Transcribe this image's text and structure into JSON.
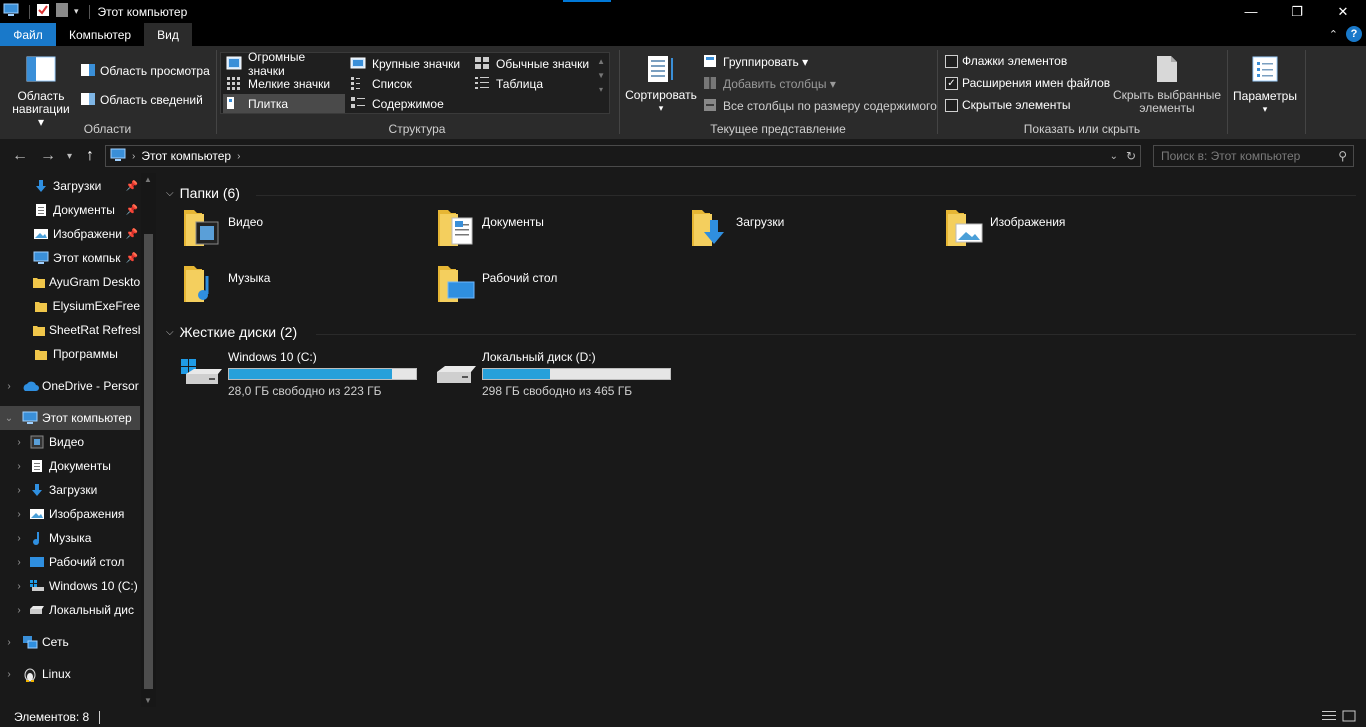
{
  "window": {
    "title": "Этот компьютер",
    "minimize": "—",
    "maximize": "❐",
    "close": "✕"
  },
  "ribbon_tabs": [
    "Файл",
    "Компьютер",
    "Вид"
  ],
  "ribbon": {
    "panes": {
      "navigation_pane": "Область\nнавигации",
      "navigation_pane_line1": "Область",
      "navigation_pane_line2": "навигации ▾",
      "preview_pane": "Область просмотра",
      "details_pane": "Область сведений",
      "label": "Области"
    },
    "layout": {
      "items": [
        "Огромные значки",
        "Крупные значки",
        "Обычные значки",
        "Мелкие значки",
        "Список",
        "Таблица",
        "Плитка",
        "Содержимое"
      ],
      "selected": "Плитка",
      "label": "Структура"
    },
    "current_view": {
      "sort_by": "Сортировать",
      "group_by": "Группировать ▾",
      "add_columns": "Добавить столбцы ▾",
      "size_all_columns": "Все столбцы по размеру содержимого",
      "label": "Текущее представление"
    },
    "show_hide": {
      "item_checkboxes": "Флажки элементов",
      "item_checkboxes_checked": false,
      "file_extensions": "Расширения имен файлов",
      "file_extensions_checked": true,
      "hidden_items": "Скрытые элементы",
      "hidden_items_checked": false,
      "hide_selected_line1": "Скрыть выбранные",
      "hide_selected_line2": "элементы",
      "label": "Показать или скрыть"
    },
    "options": "Параметры"
  },
  "address": {
    "path": "Этот компьютер",
    "search_placeholder": "Поиск в: Этот компьютер"
  },
  "sidebar": {
    "quick_access": [
      {
        "label": "Загрузки",
        "pinned": true
      },
      {
        "label": "Документы",
        "pinned": true
      },
      {
        "label": "Изображени",
        "pinned": true
      },
      {
        "label": "Этот компьк",
        "pinned": true
      },
      {
        "label": "AyuGram Deskto",
        "pinned": false
      },
      {
        "label": "ElysiumExeFree",
        "pinned": false
      },
      {
        "label": "SheetRat Refresh",
        "pinned": false
      },
      {
        "label": "Программы",
        "pinned": false
      }
    ],
    "onedrive": "OneDrive - Persor",
    "this_pc": "Этот компьютер",
    "this_pc_children": [
      "Видео",
      "Документы",
      "Загрузки",
      "Изображения",
      "Музыка",
      "Рабочий стол",
      "Windows 10 (C:)",
      "Локальный дис"
    ],
    "network": "Сеть",
    "linux": "Linux"
  },
  "main": {
    "folders_header": "Папки (6)",
    "folders": [
      "Видео",
      "Документы",
      "Загрузки",
      "Изображения",
      "Музыка",
      "Рабочий стол"
    ],
    "drives_header": "Жесткие диски (2)",
    "drives": [
      {
        "name": "Windows 10 (C:)",
        "free_text": "28,0 ГБ свободно из 223 ГБ",
        "used_fraction": 0.874
      },
      {
        "name": "Локальный диск (D:)",
        "free_text": "298 ГБ свободно из 465 ГБ",
        "used_fraction": 0.359
      }
    ]
  },
  "status": {
    "items_count": "Элементов: 8"
  },
  "colors": {
    "accent": "#1979ca",
    "folder": "#f0c64a",
    "drive_bar": "#26a0da"
  }
}
